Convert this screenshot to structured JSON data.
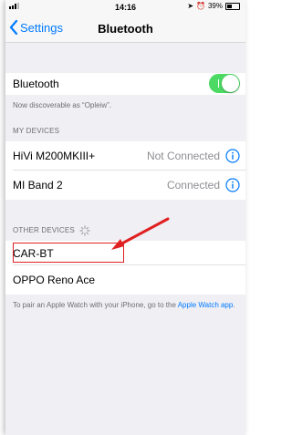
{
  "statusbar": {
    "carrier": "",
    "time": "14:16",
    "battery": "39%",
    "battery_level": 0.39
  },
  "navbar": {
    "back_label": "Settings",
    "title": "Bluetooth"
  },
  "bluetooth": {
    "label": "Bluetooth",
    "enabled": true,
    "discoverable": "Now discoverable as “Opleiw”."
  },
  "my_devices": {
    "header": "MY DEVICES",
    "items": [
      {
        "name": "HiVi M200MKIII+",
        "status": "Not Connected"
      },
      {
        "name": "MI Band 2",
        "status": "Connected"
      }
    ]
  },
  "other_devices": {
    "header": "OTHER DEVICES",
    "items": [
      {
        "name": "CAR-BT"
      },
      {
        "name": "OPPO Reno Ace"
      }
    ]
  },
  "apple_watch_note": {
    "text": "To pair an Apple Watch with your iPhone, go to the ",
    "link": "Apple Watch app",
    "end": "."
  },
  "colors": {
    "accent": "#007aff",
    "toggle_on": "#4cd964",
    "annotation": "#e02020"
  }
}
